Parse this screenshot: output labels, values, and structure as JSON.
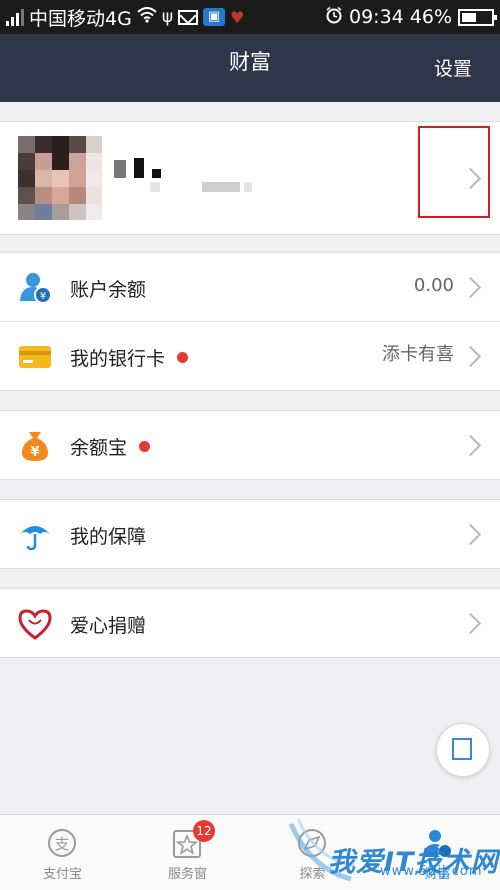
{
  "status_bar": {
    "carrier": "中国移动4G",
    "time": "09:34",
    "battery": "46%"
  },
  "header": {
    "title": "财富",
    "settings_label": "设置"
  },
  "menu": {
    "balance": {
      "label": "账户余额",
      "value": "0.00",
      "icon": "user-balance-icon"
    },
    "bank_card": {
      "label": "我的银行卡",
      "value": "添卡有喜",
      "icon": "bank-card-icon"
    },
    "yuebao": {
      "label": "余额宝",
      "icon": "money-bag-icon"
    },
    "insurance": {
      "label": "我的保障",
      "icon": "umbrella-icon"
    },
    "charity": {
      "label": "爱心捐赠",
      "icon": "heart-icon"
    }
  },
  "tab_bar": {
    "tabs": [
      {
        "label": "支付宝",
        "icon": "alipay-icon"
      },
      {
        "label": "服务窗",
        "icon": "star-icon",
        "badge": "12"
      },
      {
        "label": "探索",
        "icon": "explore-icon"
      },
      {
        "label": "财富",
        "icon": "wealth-icon"
      }
    ]
  },
  "watermark": {
    "text": "我爱IT技术网",
    "url": "www.52ij.com"
  },
  "colors": {
    "header_bg": "#2f3649",
    "highlight_box": "#d11f1f",
    "red_dot": "#e53a2f",
    "accent_blue": "#3a86d6"
  }
}
